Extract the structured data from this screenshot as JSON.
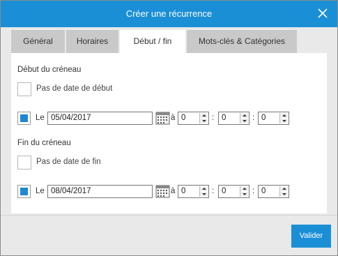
{
  "dialog": {
    "title": "Créer une récurrence",
    "tabs": [
      {
        "label": "Général"
      },
      {
        "label": "Horaires"
      },
      {
        "label": "Début / fin"
      },
      {
        "label": "Mots-clés & Catégories"
      }
    ],
    "active_tab": "Début / fin"
  },
  "start": {
    "section_title": "Début du créneau",
    "no_date_label": "Pas de date de début",
    "no_date_checked": false,
    "le_label": "Le",
    "le_selected": true,
    "date_value": "05/04/2017",
    "a_label": "à",
    "hour": "0",
    "minute": "0",
    "second": "0"
  },
  "end": {
    "section_title": "Fin du créneau",
    "no_date_label": "Pas de date de fin",
    "no_date_checked": false,
    "le_label": "Le",
    "le_selected": true,
    "date_value": "08/04/2017",
    "a_label": "à",
    "hour": "0",
    "minute": "0",
    "second": "0"
  },
  "colon": ":",
  "footer": {
    "submit_label": "Valider"
  },
  "colors": {
    "accent": "#1a8fd6",
    "tab_inactive": "#c9c9c9",
    "background": "#e9e9e9"
  },
  "icons": {
    "close": "close-icon",
    "calendar": "calendar-icon"
  }
}
